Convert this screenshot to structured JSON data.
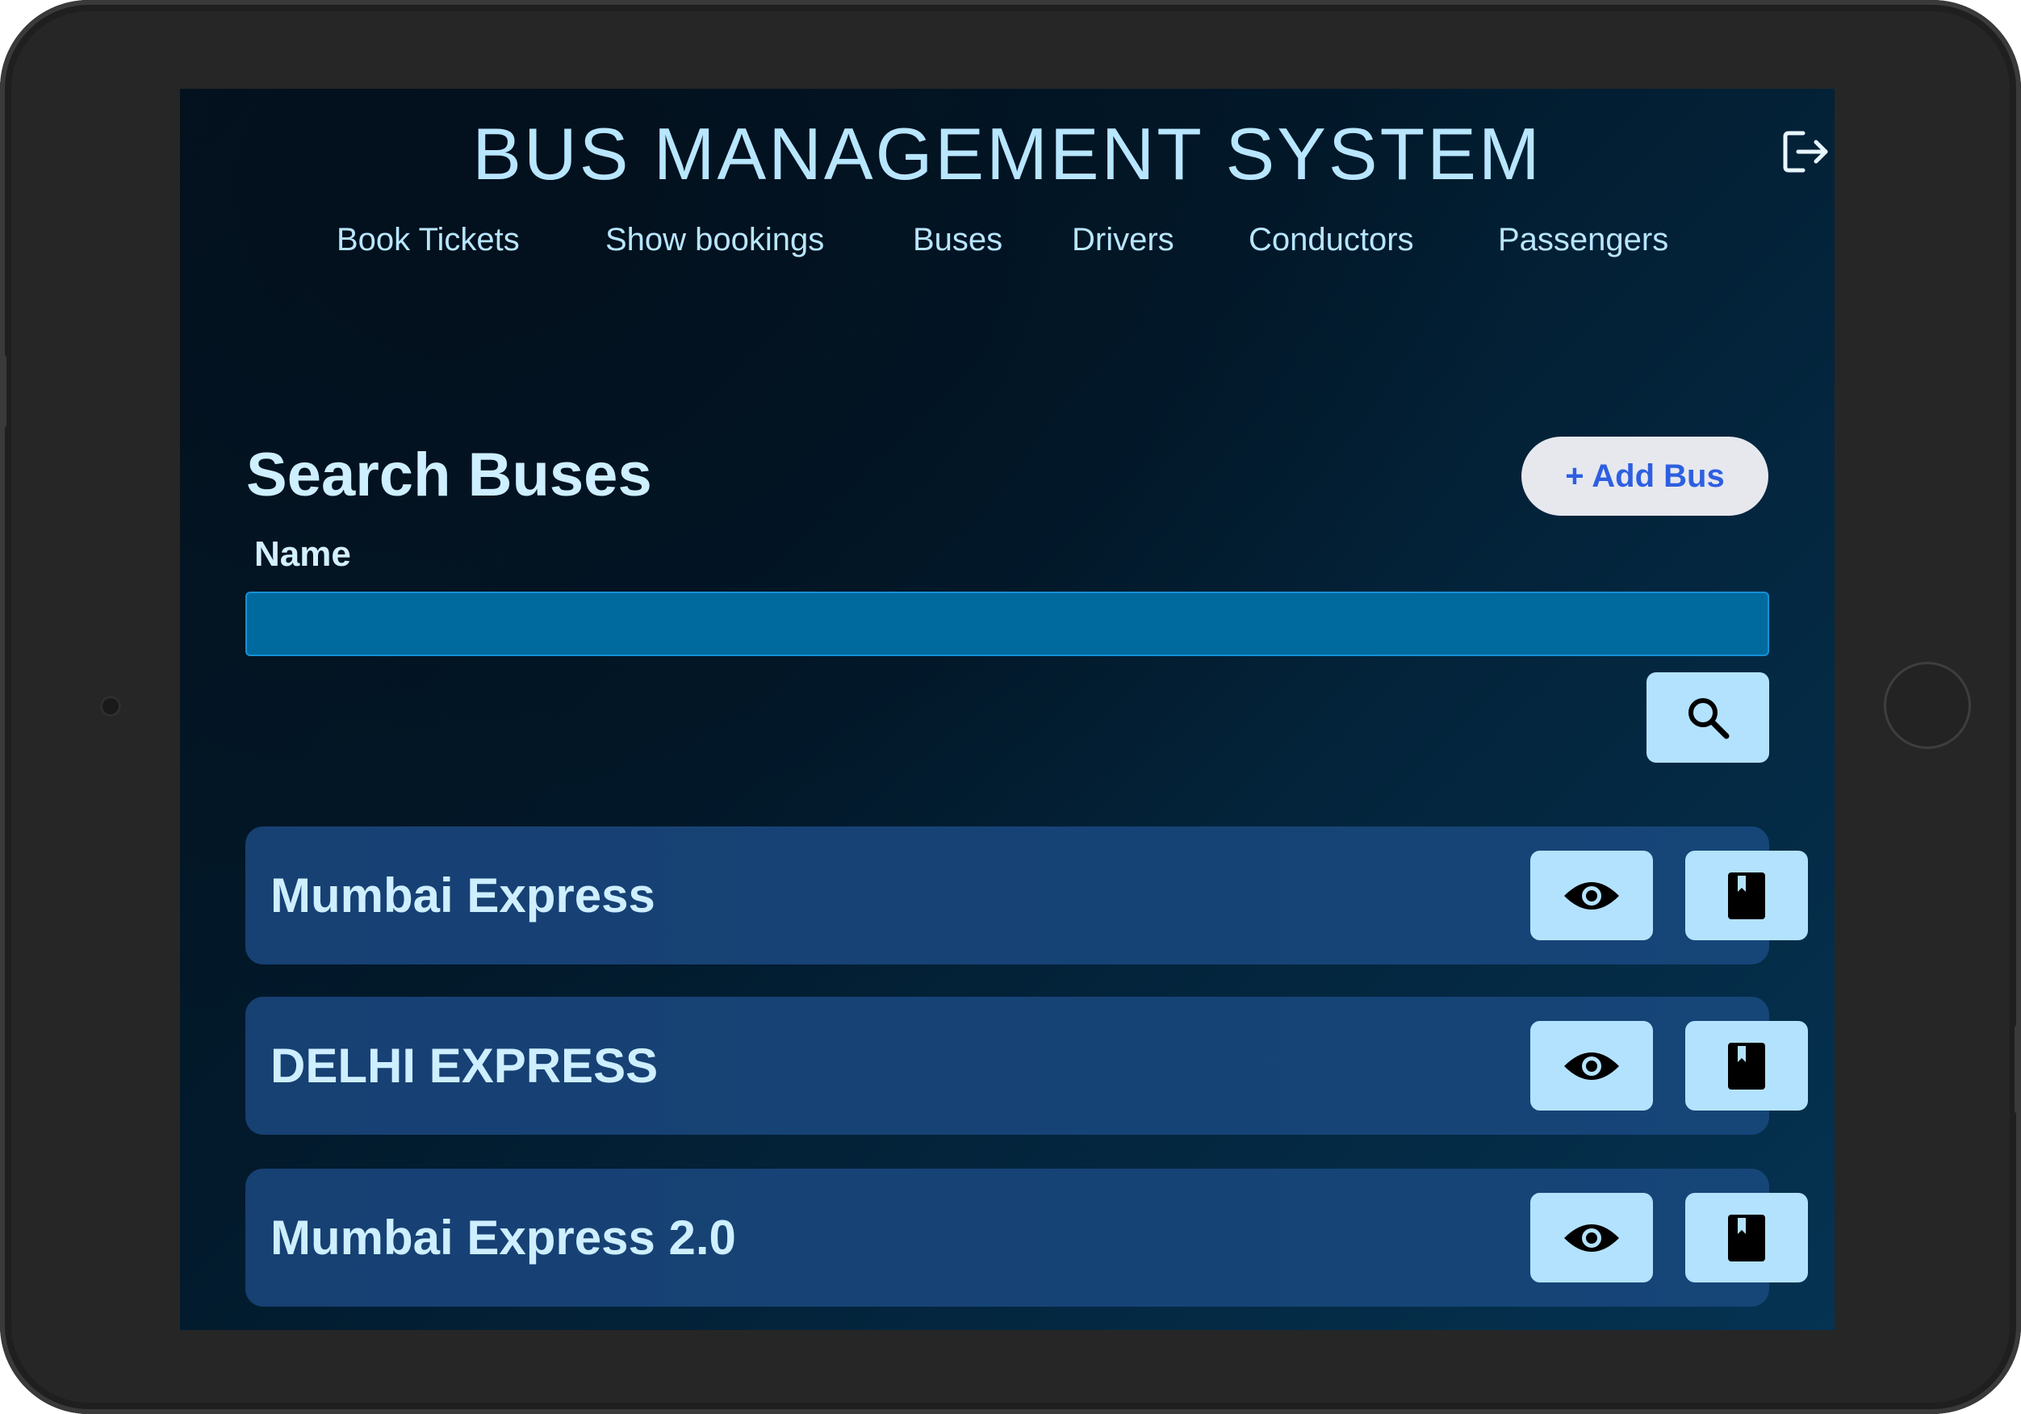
{
  "app": {
    "title": "BUS MANAGEMENT SYSTEM"
  },
  "nav": {
    "items": [
      {
        "label": "Book Tickets"
      },
      {
        "label": "Show bookings"
      },
      {
        "label": "Buses"
      },
      {
        "label": "Drivers"
      },
      {
        "label": "Conductors"
      },
      {
        "label": "Passengers"
      }
    ]
  },
  "search": {
    "title": "Search Buses",
    "add_button_label": "+ Add Bus",
    "field_label": "Name",
    "input_value": "",
    "placeholder": ""
  },
  "buses": [
    {
      "name": "Mumbai Express"
    },
    {
      "name": "DELHI EXPRESS"
    },
    {
      "name": "Mumbai Express 2.0"
    }
  ],
  "icons": {
    "logout": "logout-icon",
    "search": "search-icon",
    "view": "eye-icon",
    "book": "book-icon"
  },
  "colors": {
    "accent": "#b3e2ff",
    "add_button_text": "#2e5fe0",
    "input_background": "#006a9e",
    "row_background": "#164375"
  }
}
